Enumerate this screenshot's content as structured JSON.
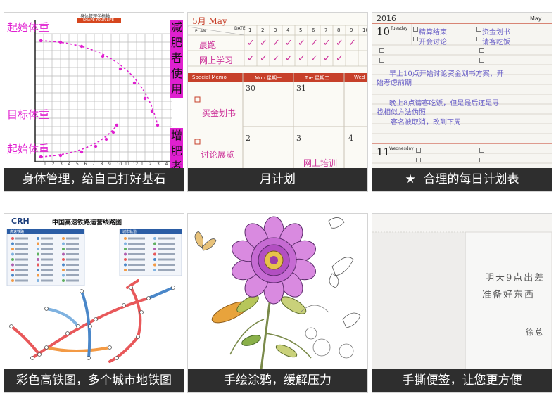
{
  "tiles": [
    {
      "caption": "身体管理，给自己打好基石",
      "chart": {
        "title": "身体管理坐标轴",
        "subtitle": "SHAPE YOUR LIFE",
        "start_weight_top": "起始体重",
        "target_weight": "目标体重",
        "start_weight_bottom": "起始体重",
        "side_lose": "减肥者使用",
        "side_gain": "增肥者",
        "x_ticks": [
          "1",
          "2",
          "3",
          "4",
          "5",
          "6",
          "7",
          "8",
          "9",
          "10",
          "11",
          "12",
          "1",
          "2",
          "3",
          "4"
        ]
      }
    },
    {
      "caption": "月计划",
      "planner": {
        "month": "5月 May",
        "plan_label": "PLAN",
        "date_label": "DATE",
        "date_cols": [
          "1",
          "2",
          "3",
          "4",
          "5",
          "6",
          "7",
          "8",
          "9",
          "10"
        ],
        "plan_rows": [
          "晨跑",
          "网上学习"
        ],
        "special_memo": "Special Memo",
        "mon": "Mon 星期一",
        "tue": "Tue 星期二",
        "wed": "Wed",
        "day30": "30",
        "day31": "31",
        "day2": "2",
        "day3": "3",
        "day4": "4",
        "memo1": "买金划书",
        "memo2": "讨论展览",
        "note": "网上培训"
      }
    },
    {
      "caption": "合理的每日计划表",
      "star": "★",
      "daily": {
        "year": "2016",
        "month": "May",
        "day10": "10",
        "weekday10": "Tuesday",
        "tasks": [
          "精算结束",
          "资金划书",
          "开会讨论",
          "请客吃饭"
        ],
        "note1": "早上10点开始讨论资金划书方案，开",
        "note2": "始考虑前期",
        "note3": "晚上8点请客吃饭，但是最后还是寻",
        "note4": "找相似方法伪照",
        "note5": "客名被取消，改到下周",
        "day11": "11",
        "weekday11": "Wednesday"
      }
    },
    {
      "caption": "彩色高铁图，多个城市地铁图",
      "map": {
        "brand": "CRH",
        "title": "中国高速铁路运营线路图",
        "legend_left": "高速铁路",
        "legend_right": "城市轨道"
      }
    },
    {
      "caption": "手绘涂鸦，缓解压力"
    },
    {
      "caption": "手撕便签，让您更方便",
      "note": {
        "line1": "明天9点出差",
        "line2": "准备好东西",
        "signature": "徐总"
      }
    }
  ]
}
